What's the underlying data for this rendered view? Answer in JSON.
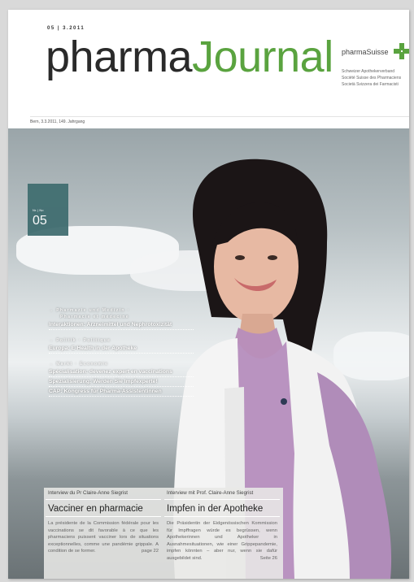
{
  "header": {
    "issue": "05 | 3.2011",
    "title_part1": "pharma",
    "title_part2": "Journal",
    "brand": "pharmaSuisse",
    "tagline": [
      "Schweizer Apothekerverband",
      "Société Suisse des Pharmaciens",
      "Società Svizzera dei Farmacisti"
    ],
    "dateline": "Bern, 3.3.2011, 149. Jahrgang"
  },
  "number_box": {
    "label": "Nr. | No",
    "number": "05"
  },
  "menu": {
    "sections": [
      {
        "label_lines": [
          "→ Pharmazie und Medizin ·",
          "Pharmacie et médecine"
        ],
        "items": [
          "Interaktionen: Arzneimittel und Nephrotoxizität"
        ]
      },
      {
        "label_lines": [
          "→ Politik · Politique"
        ],
        "items": [
          "Europa: E-Health in der Apotheke"
        ]
      },
      {
        "label_lines": [
          "→ Markt · Economie"
        ],
        "items": [
          "Spécialisation: devenez expert en vaccinations",
          "Spezialisierung: Werden Sie Impfexperte!",
          "CAP: Kongress für Pharma-Assistentinnen"
        ]
      }
    ]
  },
  "panels": {
    "left": {
      "lead": "Interview du Pr Claire-Anne Siegrist",
      "head": "Vacciner en pharmacie",
      "body": "La présidente de la Commission fédérale pour les vaccinations se dit favorable à ce que les pharmaciens puissent vacciner lors de situations exceptionnelles, comme une pandémie grippale. A condition de se former.",
      "page": "page 22"
    },
    "right": {
      "lead": "Interview mit Prof. Claire-Anne Siegrist",
      "head": "Impfen in der Apotheke",
      "body": "Die Präsidentin der Eidgenössischen Kommission für Impffragen würde es begrüssen, wenn Apothekerinnen und Apotheker in Ausnahmesituationen, wie einer Grippepandemie, impfen könnten – aber nur, wenn sie dafür ausgebildet sind.",
      "page": "Seite 26"
    }
  },
  "colors": {
    "accent_green": "#5aa33f",
    "number_box": "#3d6b6e"
  }
}
